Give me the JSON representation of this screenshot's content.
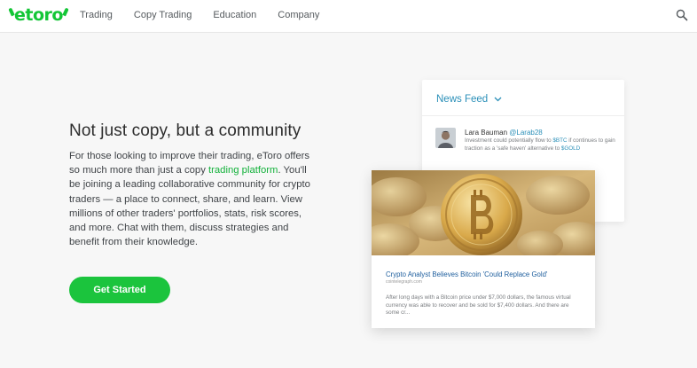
{
  "brand": {
    "name": "etoro",
    "color": "#13c636"
  },
  "nav": {
    "items": [
      {
        "label": "Trading"
      },
      {
        "label": "Copy Trading"
      },
      {
        "label": "Education"
      },
      {
        "label": "Company"
      }
    ],
    "search_icon": "search-icon"
  },
  "hero": {
    "headline": "Not just copy, but a community",
    "body_before": "For those looking to improve their trading, eToro offers so much more than just a copy ",
    "body_link": "trading platform",
    "body_after": ". You'll be joining a leading collaborative community for crypto traders — a place to connect, share, and learn. View millions of other traders' portfolios, stats, risk scores, and more. Chat with them, discuss strategies and benefit from their knowledge.",
    "cta_label": "Get Started",
    "accent": "#1bc43d"
  },
  "feed": {
    "title": "News Feed",
    "chevron_icon": "chevron-down-icon",
    "post": {
      "author": "Lara Bauman",
      "handle": "@Larab28",
      "text_1": "Investment could potentially flow to ",
      "ticker_1": "$BTC",
      "text_2": " if continues to gain traction as a 'safe haven' alternative to ",
      "ticker_2": "$GOLD"
    }
  },
  "article": {
    "title": "Crypto Analyst Believes Bitcoin 'Could Replace Gold'",
    "source": "cointelegraph.com",
    "body": "After long days with a Bitcoin price under $7,000 dollars, the famous virtual currency was able to recover and be sold for $7,400 dollars. And there are some cr..."
  }
}
